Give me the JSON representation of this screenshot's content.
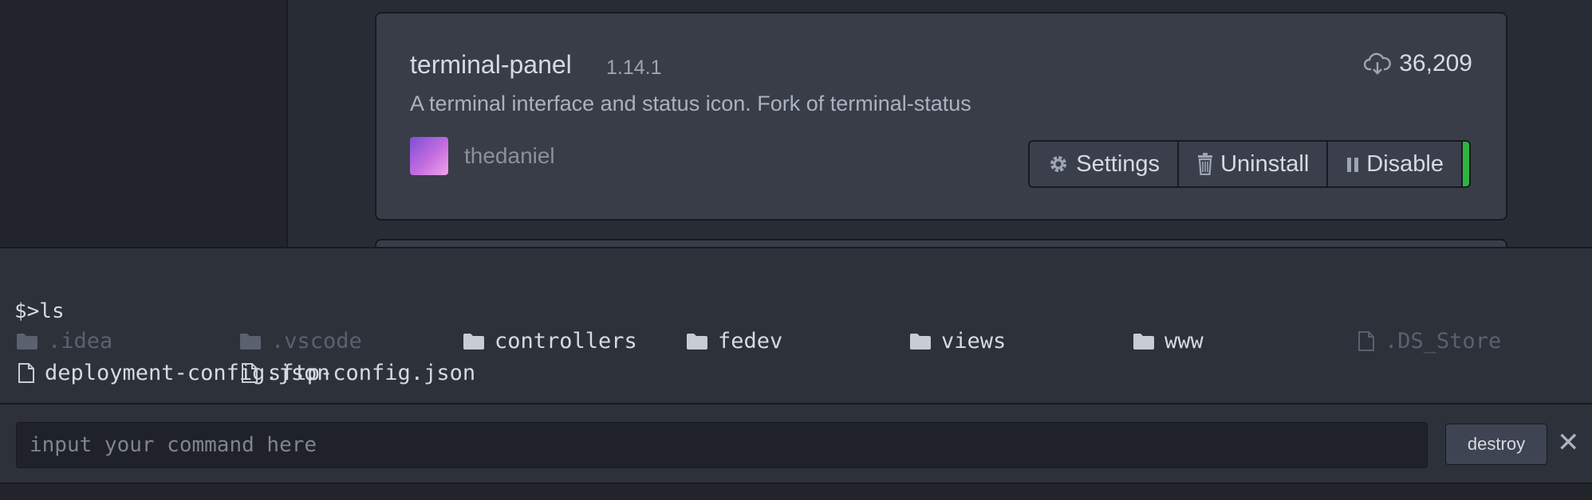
{
  "package": {
    "name": "terminal-panel",
    "version": "1.14.1",
    "downloads": "36,209",
    "description": "A terminal interface and status icon. Fork of terminal-status",
    "author": "thedaniel",
    "buttons": {
      "settings": "Settings",
      "uninstall": "Uninstall",
      "disable": "Disable"
    },
    "status_color": "#2fb344"
  },
  "terminal": {
    "prompt": "$>ls",
    "files": [
      {
        "name": ".idea",
        "icon": "folder-icon"
      },
      {
        "name": ".vscode",
        "icon": "folder-icon"
      },
      {
        "name": "controllers",
        "icon": "folder-icon"
      },
      {
        "name": "fedev",
        "icon": "folder-icon"
      },
      {
        "name": "views",
        "icon": "folder-icon"
      },
      {
        "name": "www",
        "icon": "folder-icon"
      },
      {
        "name": ".DS_Store",
        "icon": "file-icon"
      },
      {
        "name": "deployment-config.json",
        "icon": "file-icon"
      },
      {
        "name": "sftp-config.json",
        "icon": "file-icon"
      }
    ]
  },
  "command_bar": {
    "placeholder": "input your command here",
    "destroy_label": "destroy",
    "close_symbol": "✕"
  }
}
